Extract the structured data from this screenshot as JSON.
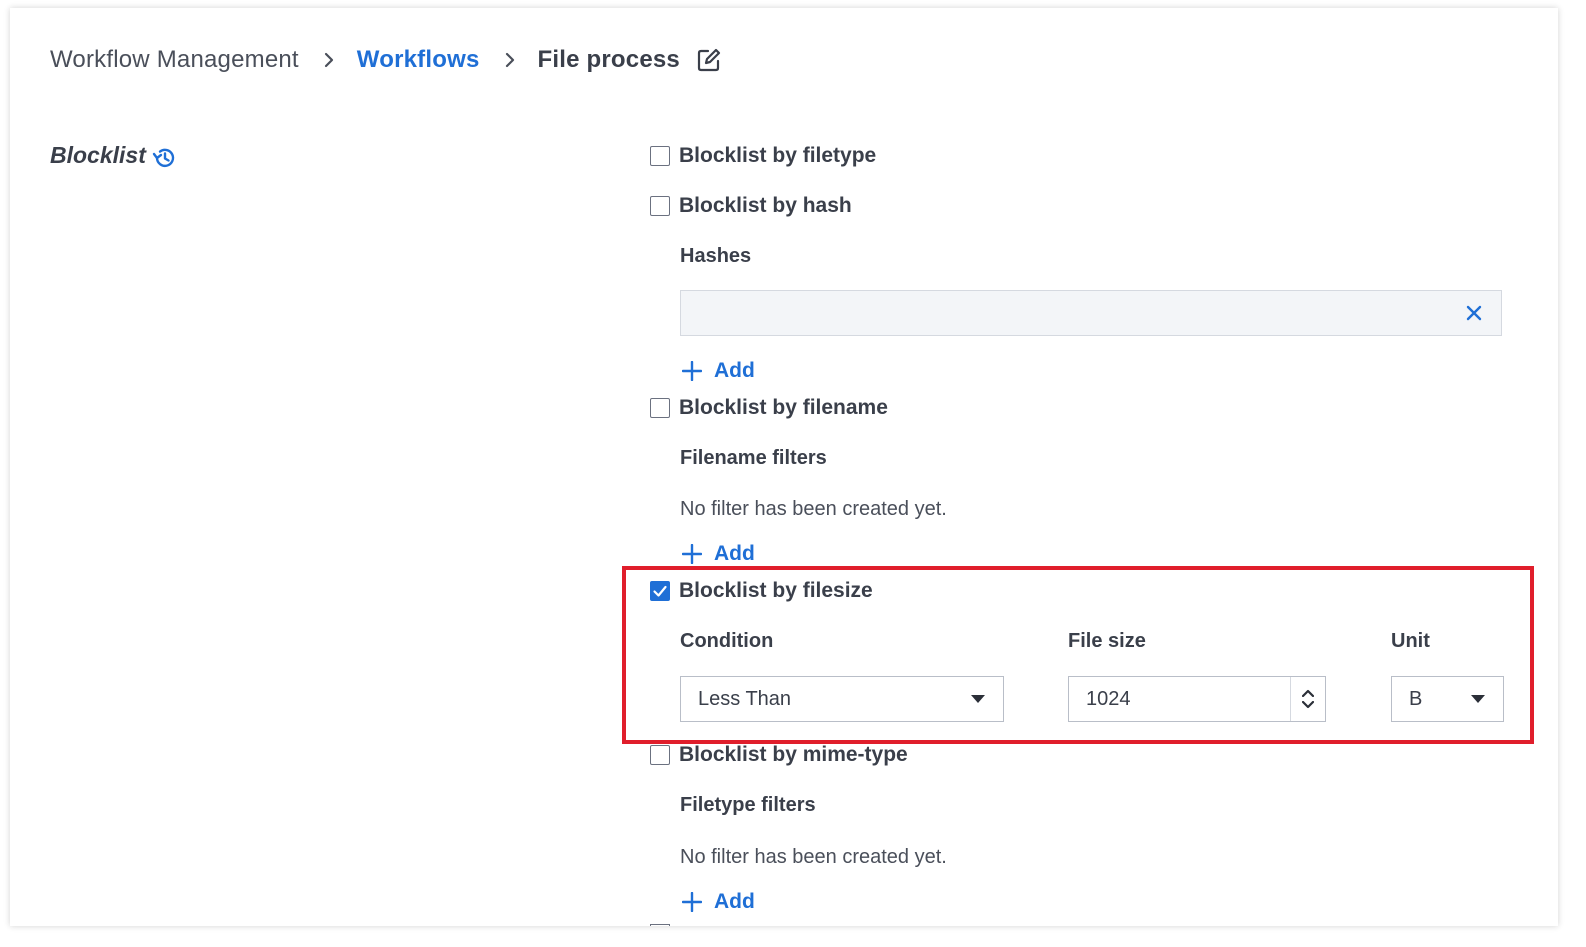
{
  "breadcrumb": {
    "root": "Workflow Management",
    "link": "Workflows",
    "current": "File process"
  },
  "section": {
    "title": "Blocklist"
  },
  "options": {
    "filetype": {
      "label": "Blocklist by filetype",
      "checked": false
    },
    "hash": {
      "label": "Blocklist by hash",
      "checked": false,
      "sublabel": "Hashes",
      "input_value": "",
      "add_label": "Add"
    },
    "filename": {
      "label": "Blocklist by filename",
      "checked": false,
      "sublabel": "Filename filters",
      "empty_text": "No filter has been created yet.",
      "add_label": "Add"
    },
    "filesize": {
      "label": "Blocklist by filesize",
      "checked": true,
      "condition_label": "Condition",
      "condition_value": "Less Than",
      "size_label": "File size",
      "size_value": "1024",
      "unit_label": "Unit",
      "unit_value": "B"
    },
    "mimetype": {
      "label": "Blocklist by mime-type",
      "checked": false,
      "sublabel": "Filetype filters",
      "empty_text": "No filter has been created yet.",
      "add_label": "Add"
    }
  },
  "colors": {
    "accent": "#1f6fd6",
    "highlight": "#e01e2b",
    "text": "#3a3f4a"
  },
  "icons": {
    "chevron": "chevron-right-icon",
    "edit": "edit-icon",
    "history": "history-icon",
    "clear": "close-icon",
    "add": "plus-icon",
    "dropdown": "caret-down-icon"
  }
}
